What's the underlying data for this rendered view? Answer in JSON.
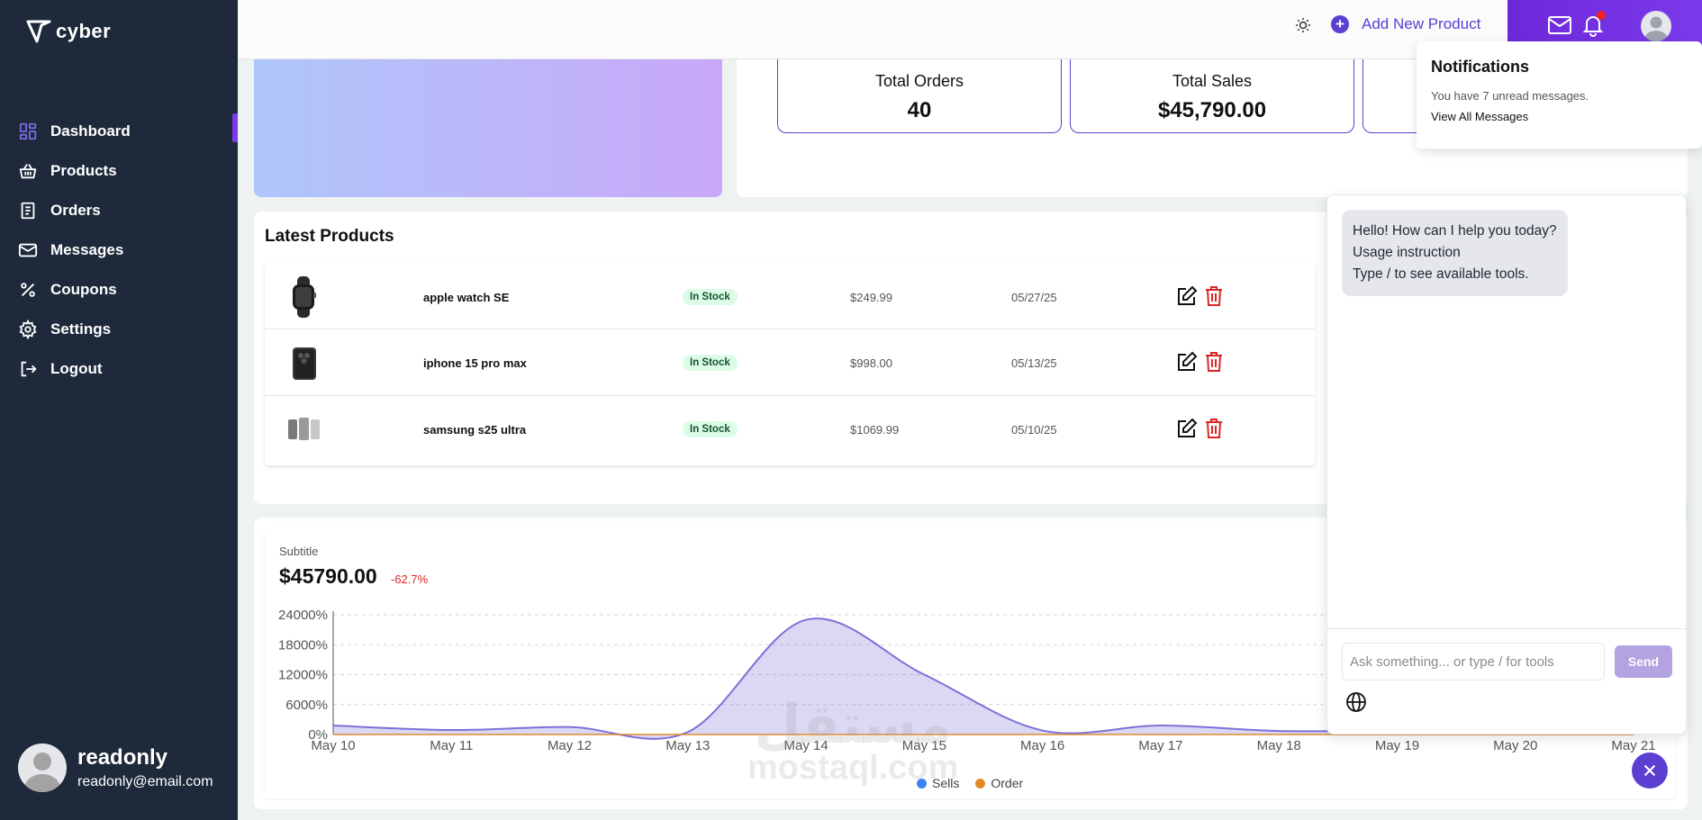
{
  "brand": {
    "name": "cyber"
  },
  "sidebar": {
    "items": [
      {
        "label": "Dashboard",
        "icon": "grid-icon"
      },
      {
        "label": "Products",
        "icon": "basket-icon"
      },
      {
        "label": "Orders",
        "icon": "clipboard-icon"
      },
      {
        "label": "Messages",
        "icon": "mail-icon"
      },
      {
        "label": "Coupons",
        "icon": "percent-icon"
      },
      {
        "label": "Settings",
        "icon": "gear-icon"
      },
      {
        "label": "Logout",
        "icon": "logout-icon"
      }
    ],
    "active": "Dashboard"
  },
  "user": {
    "name": "readonly",
    "email": "readonly@email.com"
  },
  "header": {
    "add_label": "Add New Product"
  },
  "stats": [
    {
      "label": "Total Orders",
      "value": "40"
    },
    {
      "label": "Total Sales",
      "value": "$45,790.00"
    }
  ],
  "products": {
    "title": "Latest Products",
    "rows": [
      {
        "name": "apple watch SE",
        "status": "In Stock",
        "price": "$249.99",
        "date": "05/27/25"
      },
      {
        "name": "iphone 15 pro max",
        "status": "In Stock",
        "price": "$998.00",
        "date": "05/13/25"
      },
      {
        "name": "samsung s25 ultra",
        "status": "In Stock",
        "price": "$1069.99",
        "date": "05/10/25"
      }
    ]
  },
  "chart_header": {
    "subtitle": "Subtitle",
    "value": "$45790.00",
    "change": "-62.7%"
  },
  "chart_data": {
    "type": "area",
    "x": [
      "May 10",
      "May 11",
      "May 12",
      "May 13",
      "May 14",
      "May 15",
      "May 16",
      "May 17",
      "May 18",
      "May 19",
      "May 20",
      "May 21"
    ],
    "y_ticks": [
      "0%",
      "6000%",
      "12000%",
      "18000%",
      "24000%"
    ],
    "ylim": [
      0,
      24000
    ],
    "series": [
      {
        "name": "Sells",
        "color": "#7c72d8",
        "values": [
          1800,
          900,
          1500,
          500,
          23000,
          12000,
          800,
          1800,
          700,
          800,
          500,
          700
        ]
      },
      {
        "name": "Order",
        "color": "#e08a2c",
        "values": [
          0,
          0,
          0,
          0,
          0,
          0,
          0,
          0,
          0,
          0,
          0,
          0
        ]
      }
    ],
    "grid": true,
    "legend": "bottom"
  },
  "notifications": {
    "title": "Notifications",
    "subtitle": "You have 7 unread messages.",
    "link": "View All Messages"
  },
  "chat": {
    "messages": [
      "Hello! How can I help you today?",
      "Usage instruction",
      "Type / to see available tools."
    ],
    "placeholder": "Ask something... or type / for tools",
    "send": "Send"
  },
  "watermark": {
    "arabic": "مستقل",
    "latin": "mostaql.com"
  },
  "colors": {
    "sidebar": "#1e293b",
    "accent": "#5b3fd1",
    "danger": "#dc2626",
    "success_bg": "#dcfce7"
  }
}
